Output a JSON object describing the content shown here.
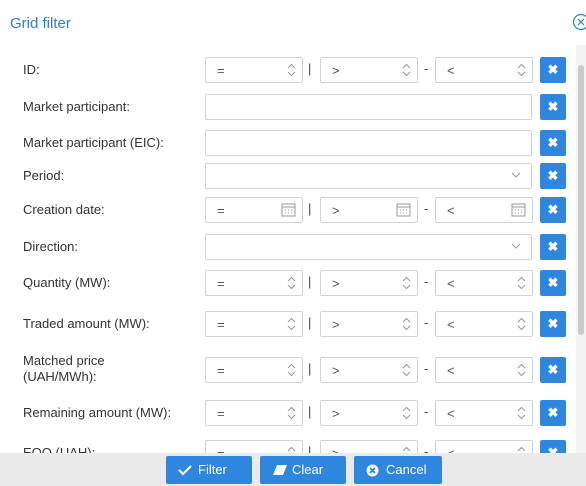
{
  "dialog": {
    "title": "Grid filter"
  },
  "operators": {
    "eq": "=",
    "gt": ">",
    "lt": "<",
    "pipe": "|",
    "dash": "-"
  },
  "fields": {
    "id": "ID:",
    "market_participant": "Market participant:",
    "market_participant_eic": "Market participant (EIC):",
    "period": "Period:",
    "creation_date": "Creation date:",
    "direction": "Direction:",
    "quantity": "Quantity (MW):",
    "traded_amount": "Traded amount (MW):",
    "matched_price": "Matched price (UAH/MWh):",
    "remaining_amount": "Remaining amount (MW):",
    "eoo": "EOO (UAH):"
  },
  "buttons": {
    "filter": "Filter",
    "clear": "Clear",
    "cancel": "Cancel"
  },
  "colors": {
    "accent": "#2e86de",
    "title": "#2e7fc8"
  }
}
